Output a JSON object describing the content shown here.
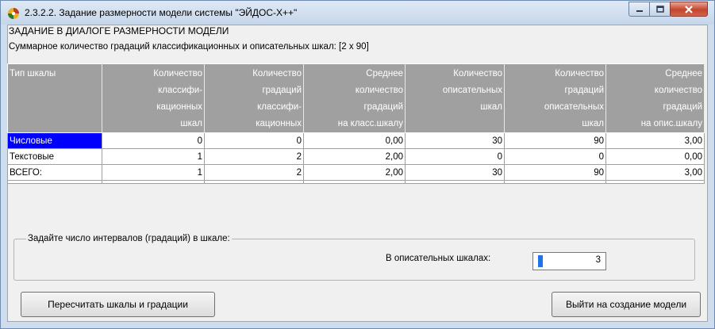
{
  "window": {
    "title": "2.3.2.2. Задание размерности модели системы \"ЭЙДОС-Х++\""
  },
  "heading": "ЗАДАНИЕ В ДИАЛОГЕ РАЗМЕРНОСТИ МОДЕЛИ",
  "summary": "Суммарное количество градаций классификационных и описательных шкал: [2 x 90]",
  "table": {
    "columns": [
      [
        "Тип шкалы"
      ],
      [
        "Количество",
        "классифи-",
        "кационных",
        "шкал"
      ],
      [
        "Количество",
        "градаций",
        "классифи-",
        "кационных"
      ],
      [
        "Среднее",
        "количество",
        "градаций",
        "на класс.шкалу"
      ],
      [
        "Количество",
        "описательных",
        "шкал"
      ],
      [
        "Количество",
        "градаций",
        "описательных",
        "шкал"
      ],
      [
        "Среднее",
        "количество",
        "градаций",
        "на опис.шкалу"
      ]
    ],
    "rows": [
      [
        "Числовые",
        "0",
        "0",
        "0,00",
        "30",
        "90",
        "3,00"
      ],
      [
        "Текстовые",
        "1",
        "2",
        "2,00",
        "0",
        "0",
        "0,00"
      ],
      [
        "ВСЕГО:",
        "1",
        "2",
        "2,00",
        "30",
        "90",
        "3,00"
      ]
    ],
    "selected_row": 0
  },
  "intervals": {
    "group_title": "Задайте число интервалов (градаций) в шкале:",
    "descriptive_label": "В описательных шкалах:",
    "descriptive_value": "3"
  },
  "buttons": {
    "recalc": "Пересчитать шкалы и градации",
    "exit": "Выйти на создание модели"
  },
  "colors": {
    "header_bg": "#a0a0a0",
    "selection": "#0000ff",
    "spin_accent": "#1e73e8"
  }
}
